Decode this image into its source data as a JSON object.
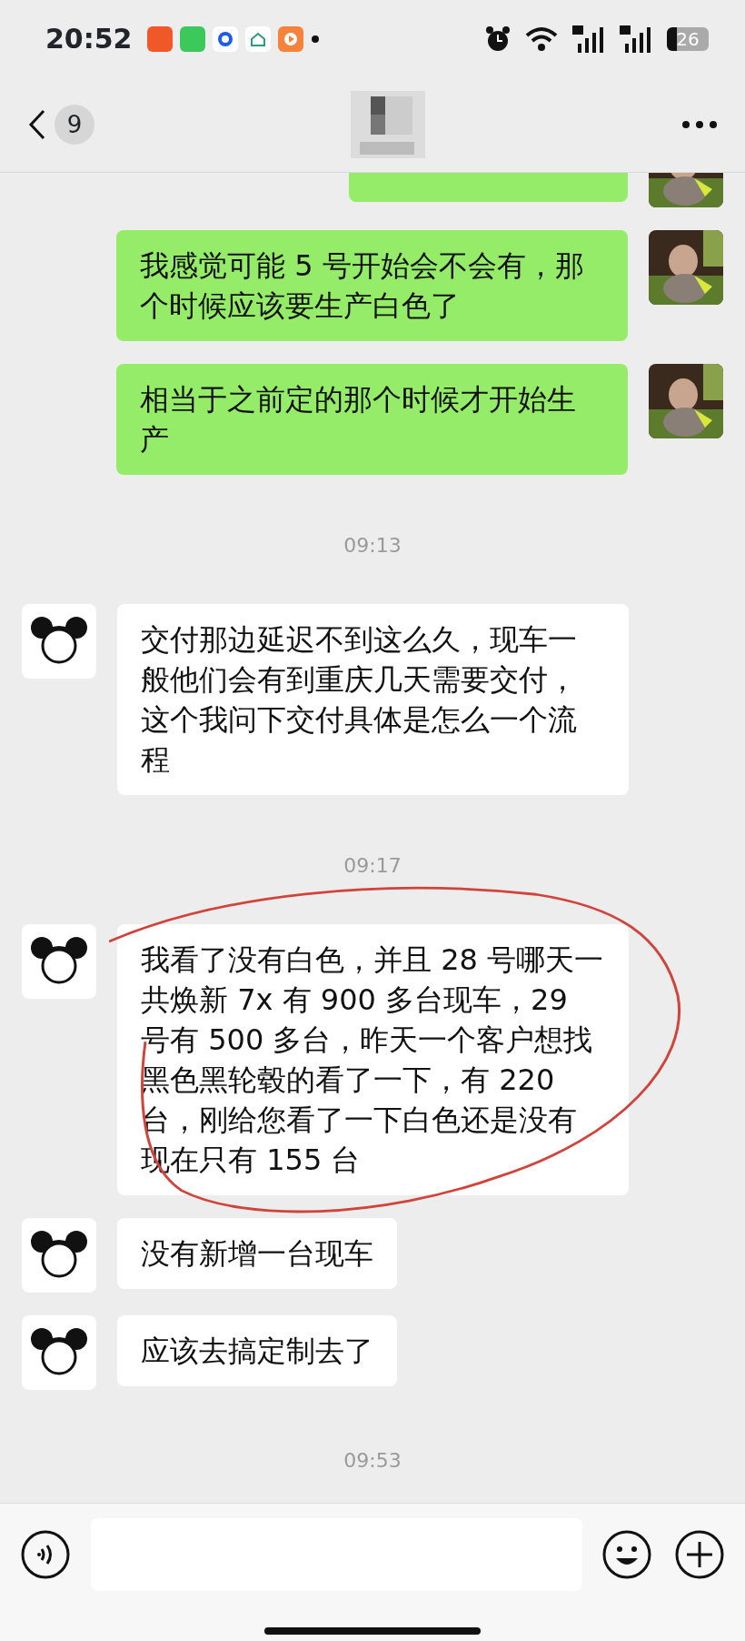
{
  "status_bar": {
    "time": "20:52",
    "battery": "26"
  },
  "header": {
    "unread_count": "9"
  },
  "messages": [
    {
      "kind": "partial",
      "outgoing": true
    },
    {
      "kind": "message",
      "outgoing": true,
      "text": "我感觉可能 5 号开始会不会有，那个时候应该要生产白色了"
    },
    {
      "kind": "message",
      "outgoing": true,
      "text": "相当于之前定的那个时候才开始生产"
    },
    {
      "kind": "time",
      "text": "09:13"
    },
    {
      "kind": "message",
      "outgoing": false,
      "text": "交付那边延迟不到这么久，现车一般他们会有到重庆几天需要交付，这个我问下交付具体是怎么一个流程"
    },
    {
      "kind": "time",
      "text": "09:17"
    },
    {
      "kind": "message",
      "outgoing": false,
      "circled": true,
      "text": "我看了没有白色，并且 28 号哪天一共焕新 7x 有 900 多台现车，29 号有 500 多台，昨天一个客户想找黑色黑轮毂的看了一下，有 220 台，刚给您看了一下白色还是没有现在只有 155 台"
    },
    {
      "kind": "message",
      "outgoing": false,
      "text": "没有新增一台现车"
    },
    {
      "kind": "message",
      "outgoing": false,
      "text": "应该去搞定制去了"
    },
    {
      "kind": "time",
      "text": "09:53"
    }
  ]
}
